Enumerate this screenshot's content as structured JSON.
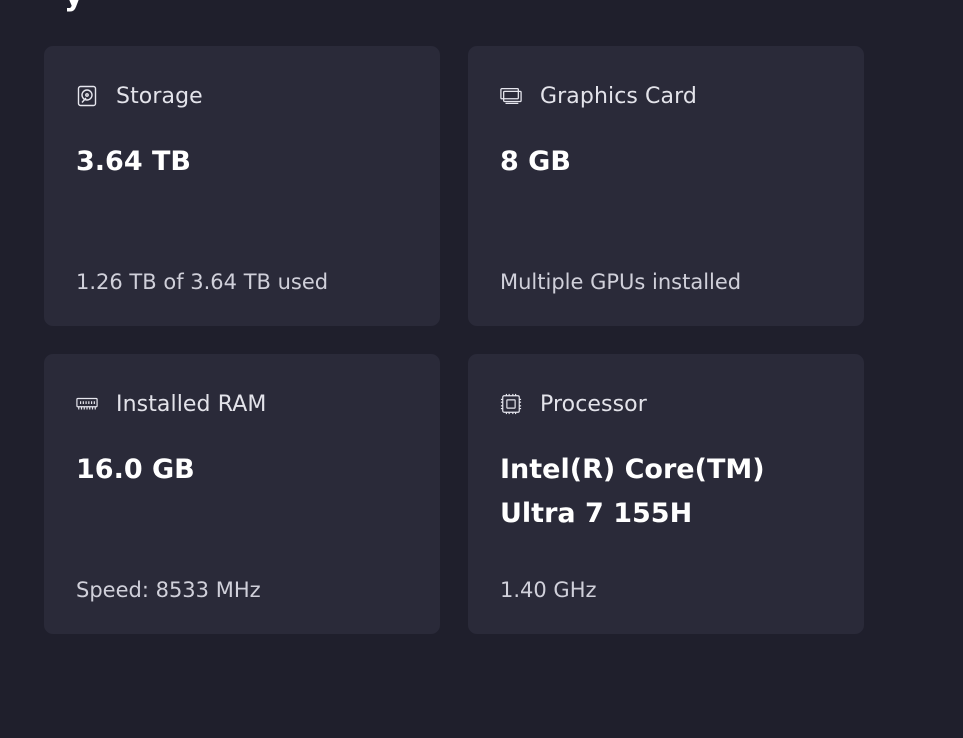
{
  "cards": [
    {
      "title": "Storage",
      "value": "3.64 TB",
      "sub": "1.26 TB of 3.64 TB used",
      "icon": "storage-drive-icon"
    },
    {
      "title": "Graphics Card",
      "value": "8 GB",
      "sub": "Multiple GPUs installed",
      "icon": "graphics-card-icon"
    },
    {
      "title": "Installed RAM",
      "value": "16.0 GB",
      "sub": "Speed: 8533 MHz",
      "icon": "ram-icon"
    },
    {
      "title": "Processor",
      "value": "Intel(R) Core(TM) Ultra 7 155H",
      "sub": "1.40 GHz",
      "icon": "processor-icon"
    }
  ],
  "colors": {
    "background": "#1f1f2c",
    "card": "#2a2a39",
    "text_primary": "#ffffff",
    "text_secondary": "#d0d0da"
  }
}
